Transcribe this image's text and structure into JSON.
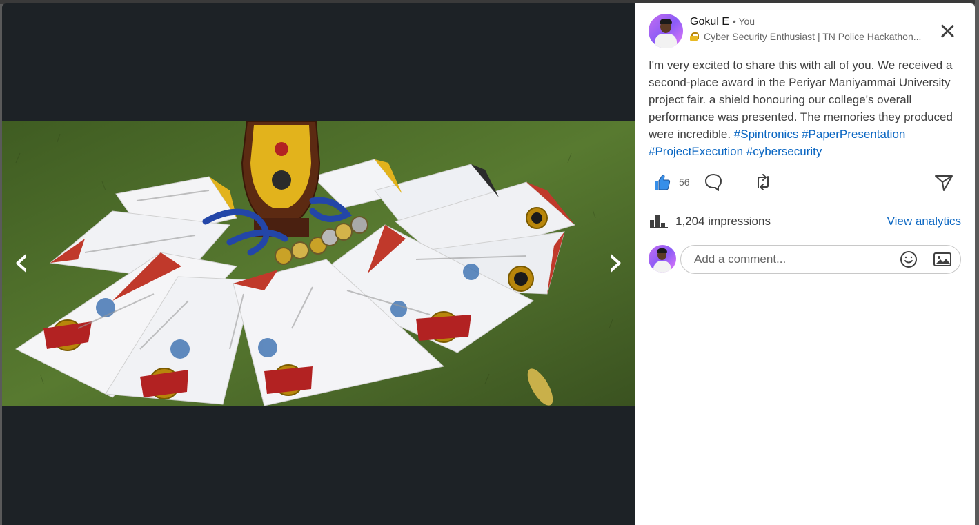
{
  "author": {
    "name": "Gokul E",
    "relation": "• You",
    "headline": "Cyber Security Enthusiast | TN Police Hackathon..."
  },
  "post": {
    "text_parts": [
      {
        "type": "text",
        "value": "I'm very excited to share this with all of you. We received a second-place award in the Periyar Maniyammai University project fair. a shield honouring our college's overall performance was presented. The memories they produced were incredible. "
      },
      {
        "type": "hashtag",
        "value": "#Spintronics"
      },
      {
        "type": "text",
        "value": " "
      },
      {
        "type": "hashtag",
        "value": "#PaperPresentation"
      },
      {
        "type": "text",
        "value": " "
      },
      {
        "type": "hashtag",
        "value": "#ProjectExecution"
      },
      {
        "type": "text",
        "value": " "
      },
      {
        "type": "hashtag",
        "value": "#cybersecurity"
      }
    ]
  },
  "reactions": {
    "like_count": "56"
  },
  "analytics": {
    "impressions": "1,204 impressions",
    "view_label": "View analytics"
  },
  "comment_box": {
    "placeholder": "Add a comment..."
  },
  "media": {
    "prev_arrow": "‹",
    "next_arrow": "›"
  },
  "colors": {
    "accent": "#0a66c2",
    "like": "#378fe9",
    "media_background": "#1d2226"
  },
  "icons": [
    "lock-icon",
    "close-icon",
    "like-icon",
    "comment-icon",
    "repost-icon",
    "send-icon",
    "analytics-icon",
    "emoji-icon",
    "image-icon"
  ]
}
